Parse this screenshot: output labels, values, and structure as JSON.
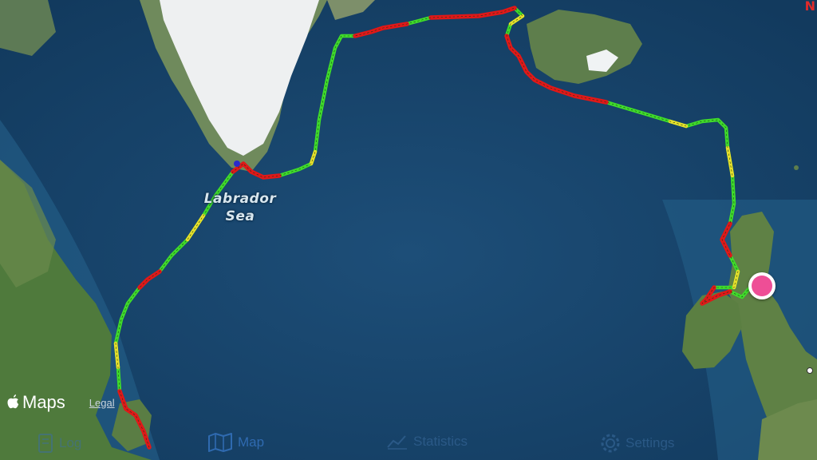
{
  "colors": {
    "ocean": "#1d4e78",
    "track_good": "#3fdc2a",
    "track_mid": "#e8e02a",
    "track_bad": "#e01818",
    "location_pin": "#ee4e96",
    "tab_active": "#2f6ab0"
  },
  "map": {
    "sea_label_line1": "Labrador",
    "sea_label_line2": "Sea",
    "compass_label": "N"
  },
  "attribution": {
    "brand": "Maps",
    "legal": "Legal"
  },
  "tabs": [
    {
      "label": "Log",
      "icon": "logbook-icon",
      "active": false
    },
    {
      "label": "Map",
      "icon": "map-icon",
      "active": true
    },
    {
      "label": "Statistics",
      "icon": "chart-icon",
      "active": false
    },
    {
      "label": "Settings",
      "icon": "gear-icon",
      "active": false
    }
  ]
}
